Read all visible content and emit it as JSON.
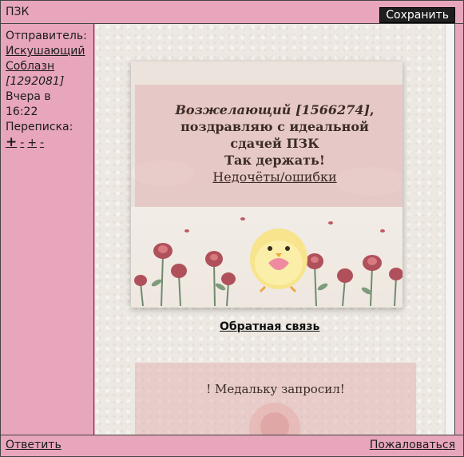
{
  "window": {
    "title": "ПЗК",
    "save_label": "Сохранить"
  },
  "sidebar": {
    "sender_label": "Отправитель:",
    "sender_name_line1": "Искушающий",
    "sender_name_line2": "Соблазн",
    "sender_id": "[1292081]",
    "time_line1": "Вчера в",
    "time_line2": "16:22",
    "correspondence_label": "Переписка:",
    "correspondence_links": [
      "+",
      "-",
      "+",
      "-"
    ]
  },
  "message": {
    "recipient": "Возжелающий [1566274]",
    "line1_suffix": ",",
    "line2": "поздравляю с идеальной",
    "line3": "сдачей ПЗК",
    "line4": "Так держать!",
    "errors_link": "Недочёты/ошибки",
    "feedback_link": "Обратная связь",
    "medal_text": "! Медальку запросил!"
  },
  "footer": {
    "reply_label": "Ответить",
    "report_label": "Пожаловаться"
  },
  "colors": {
    "frame": "#e7a6bb",
    "button": "#1e1e1e",
    "pink_box": "#e1b4b4"
  }
}
